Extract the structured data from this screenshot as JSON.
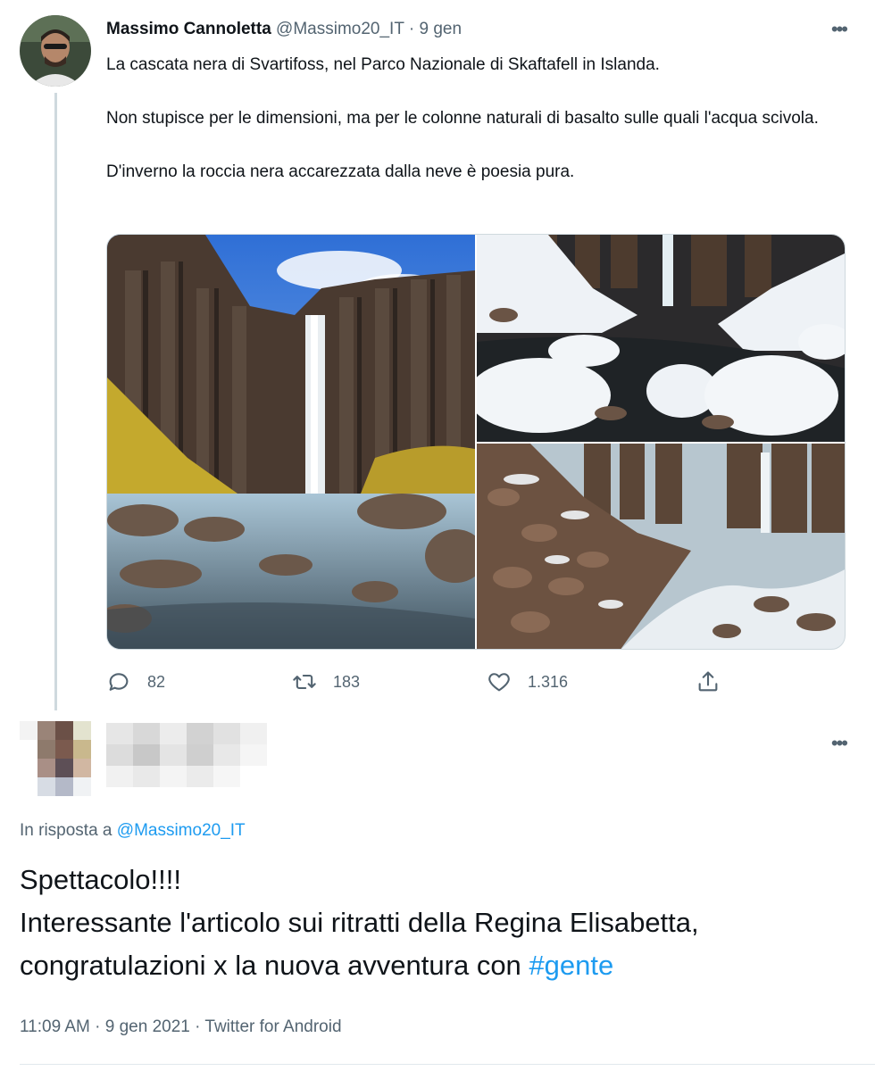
{
  "tweet": {
    "author_name": "Massimo Cannoletta",
    "author_handle": "@Massimo20_IT",
    "separator": "·",
    "date": "9 gen",
    "more_label": "•••",
    "text_line1": "La cascata nera di Svartifoss, nel Parco Nazionale di Skaftafell in Islanda.",
    "text_line2": "Non stupisce per le dimensioni, ma per le colonne naturali di basalto sulle quali l'acqua scivola.",
    "text_line3": "D'inverno la roccia nera accarezzata dalla neve è poesia pura.",
    "media": [
      "waterfall-summer-photo",
      "snowy-stream-photo",
      "snowy-canyon-photo"
    ],
    "actions": {
      "replies": "82",
      "retweets": "183",
      "likes": "1.316"
    }
  },
  "reply": {
    "more_label": "•••",
    "in_reply_prefix": "In risposta a",
    "in_reply_handle": "@Massimo20_IT",
    "text_line1": "Spettacolo!!!!",
    "text_line2": "Interessante l'articolo sui ritratti della Regina Elisabetta,",
    "text_line3_prefix": "congratulazioni x la nuova avventura con",
    "hashtag": "#gente",
    "time": "11:09 AM",
    "separator": "·",
    "date": "9 gen 2021",
    "source": "Twitter for Android"
  },
  "colors": {
    "link": "#1d9bf0",
    "secondary_text": "#536471",
    "primary_text": "#0f1419"
  }
}
